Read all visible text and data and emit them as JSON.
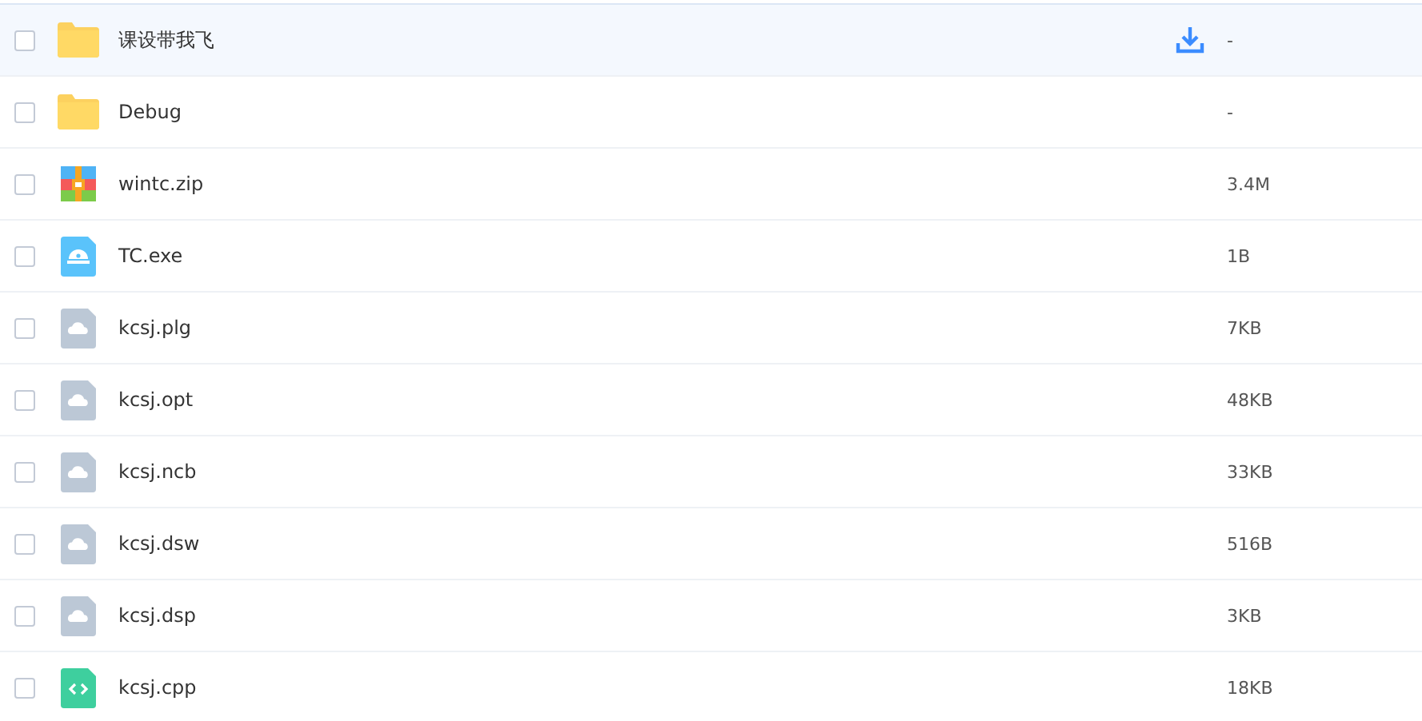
{
  "files": [
    {
      "name": "课设带我飞",
      "kind": "folder",
      "size": "-",
      "checked": false,
      "hovered": true
    },
    {
      "name": "Debug",
      "kind": "folder",
      "size": "-",
      "checked": false,
      "hovered": false
    },
    {
      "name": "wintc.zip",
      "kind": "zip",
      "size": "3.4M",
      "checked": false,
      "hovered": false
    },
    {
      "name": "TC.exe",
      "kind": "exe",
      "size": "1B",
      "checked": false,
      "hovered": false
    },
    {
      "name": "kcsj.plg",
      "kind": "file",
      "size": "7KB",
      "checked": false,
      "hovered": false
    },
    {
      "name": "kcsj.opt",
      "kind": "file",
      "size": "48KB",
      "checked": false,
      "hovered": false
    },
    {
      "name": "kcsj.ncb",
      "kind": "file",
      "size": "33KB",
      "checked": false,
      "hovered": false
    },
    {
      "name": "kcsj.dsw",
      "kind": "file",
      "size": "516B",
      "checked": false,
      "hovered": false
    },
    {
      "name": "kcsj.dsp",
      "kind": "file",
      "size": "3KB",
      "checked": false,
      "hovered": false
    },
    {
      "name": "kcsj.cpp",
      "kind": "code",
      "size": "18KB",
      "checked": false,
      "hovered": false
    }
  ]
}
